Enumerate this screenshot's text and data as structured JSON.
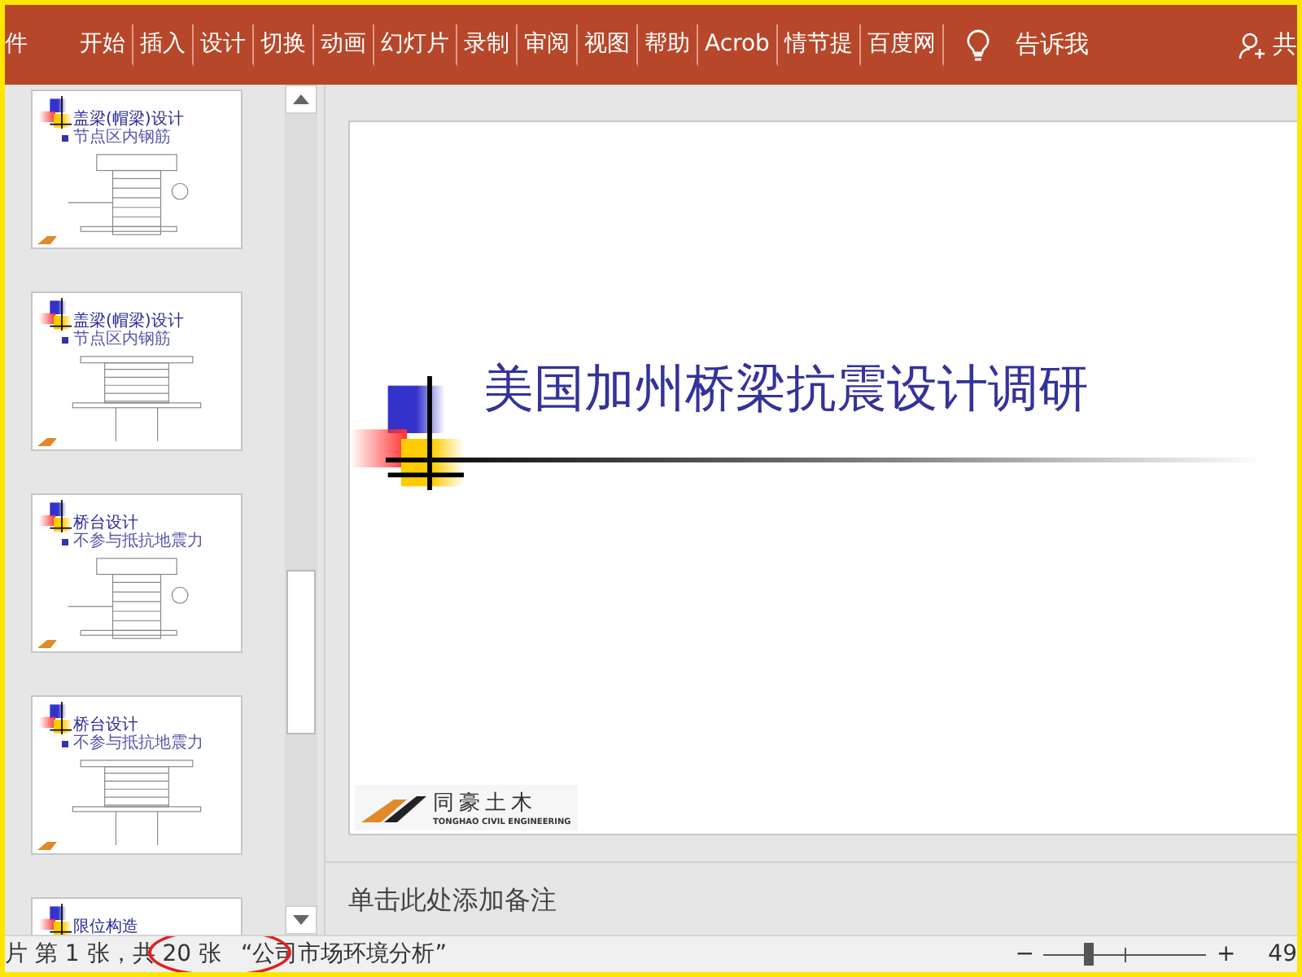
{
  "ribbon": {
    "tabs": [
      {
        "label": "件",
        "selected": false
      },
      {
        "label": "开始",
        "selected": false
      },
      {
        "label": "插入",
        "selected": false
      },
      {
        "label": "设计",
        "selected": false
      },
      {
        "label": "切换",
        "selected": false
      },
      {
        "label": "动画",
        "selected": false
      },
      {
        "label": "幻灯片",
        "selected": false
      },
      {
        "label": "录制",
        "selected": false
      },
      {
        "label": "审阅",
        "selected": false
      },
      {
        "label": "视图",
        "selected": false
      },
      {
        "label": "帮助",
        "selected": false
      },
      {
        "label": "Acrob",
        "selected": false
      },
      {
        "label": "情节提",
        "selected": false
      },
      {
        "label": "百度网",
        "selected": false
      }
    ],
    "tell_me": "告诉我",
    "share": "共"
  },
  "thumbnails": [
    {
      "title": "盖梁(帽梁)设计",
      "subtitle": "节点区内钢筋",
      "kind": "section",
      "selected": false
    },
    {
      "title": "盖梁(帽梁)设计",
      "subtitle": "节点区内钢筋",
      "kind": "elevation",
      "selected": false
    },
    {
      "title": "桥台设计",
      "subtitle": "不参与抵抗地震力",
      "kind": "section",
      "selected": false
    },
    {
      "title": "桥台设计",
      "subtitle": "不参与抵抗地震力",
      "kind": "elevation",
      "selected": false
    },
    {
      "title": "限位构造",
      "kind": "blank",
      "selected": false
    }
  ],
  "slide": {
    "title": "美国加州桥梁抗震设计调研",
    "logo_text": "同豪土木",
    "logo_subtext": "TONGHAO CIVIL ENGINEERING"
  },
  "notes": {
    "placeholder": "单击此处添加备注"
  },
  "status_bar": {
    "slide_info": "片 第 1 张，共 20 张",
    "theme": "“公司市场环境分析”",
    "zoom": {
      "zoom_out": "−",
      "zoom_in": "+",
      "level": 0.28,
      "reading": "49"
    }
  }
}
